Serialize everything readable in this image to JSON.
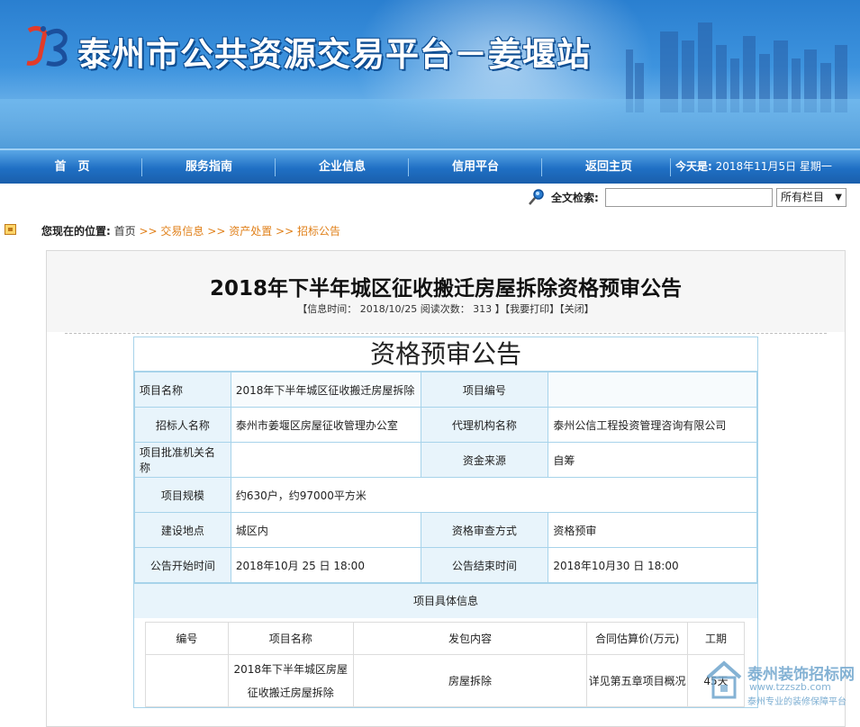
{
  "header": {
    "site_title": "泰州市公共资源交易平台－姜堰站"
  },
  "nav": {
    "items": [
      "首　页",
      "服务指南",
      "企业信息",
      "信用平台",
      "返回主页"
    ],
    "date_label": "今天是:",
    "date_value": "2018年11月5日 星期一"
  },
  "search": {
    "label": "全文检索:",
    "value": "",
    "select_value": "所有栏目"
  },
  "breadcrumb": {
    "label": "您现在的位置:",
    "home": "首页",
    "sep": ">>",
    "items": [
      "交易信息",
      "资产处置",
      "招标公告"
    ]
  },
  "article": {
    "title": "2018年下半年城区征收搬迁房屋拆除资格预审公告",
    "meta": "【信息时间： 2018/10/25  阅读次数： 313 】【我要打印】【关闭】"
  },
  "notice": {
    "title": "资格预审公告",
    "rows": [
      {
        "k1": "项目名称",
        "v1": "2018年下半年城区征收搬迁房屋拆除",
        "k2": "项目编号",
        "v2": ""
      },
      {
        "k1": "招标人名称",
        "v1": "泰州市姜堰区房屋征收管理办公室",
        "k2": "代理机构名称",
        "v2": "泰州公信工程投资管理咨询有限公司"
      },
      {
        "k1": "项目批准机关名称",
        "v1": "",
        "k2": "资金来源",
        "v2": "自筹"
      },
      {
        "k1": "项目规模",
        "v1": "约630户，约97000平方米"
      },
      {
        "k1": "建设地点",
        "v1": "城区内",
        "k2": "资格审查方式",
        "v2": "资格预审"
      },
      {
        "k1": "公告开始时间",
        "v1": "2018年10月 25 日 18:00",
        "k2": "公告结束时间",
        "v2": "2018年10月30 日 18:00"
      }
    ],
    "detail_heading": "项目具体信息",
    "detail_headers": [
      "编号",
      "项目名称",
      "发包内容",
      "合同估算价(万元)",
      "工期"
    ],
    "detail_row": [
      "",
      "2018年下半年城区房屋征收搬迁房屋拆除",
      "房屋拆除",
      "详见第五章项目概况",
      "45天"
    ]
  },
  "watermark": {
    "name": "泰州装饰招标网",
    "url": "www.tzzszb.com",
    "slogan": "泰州专业的装修保障平台"
  }
}
